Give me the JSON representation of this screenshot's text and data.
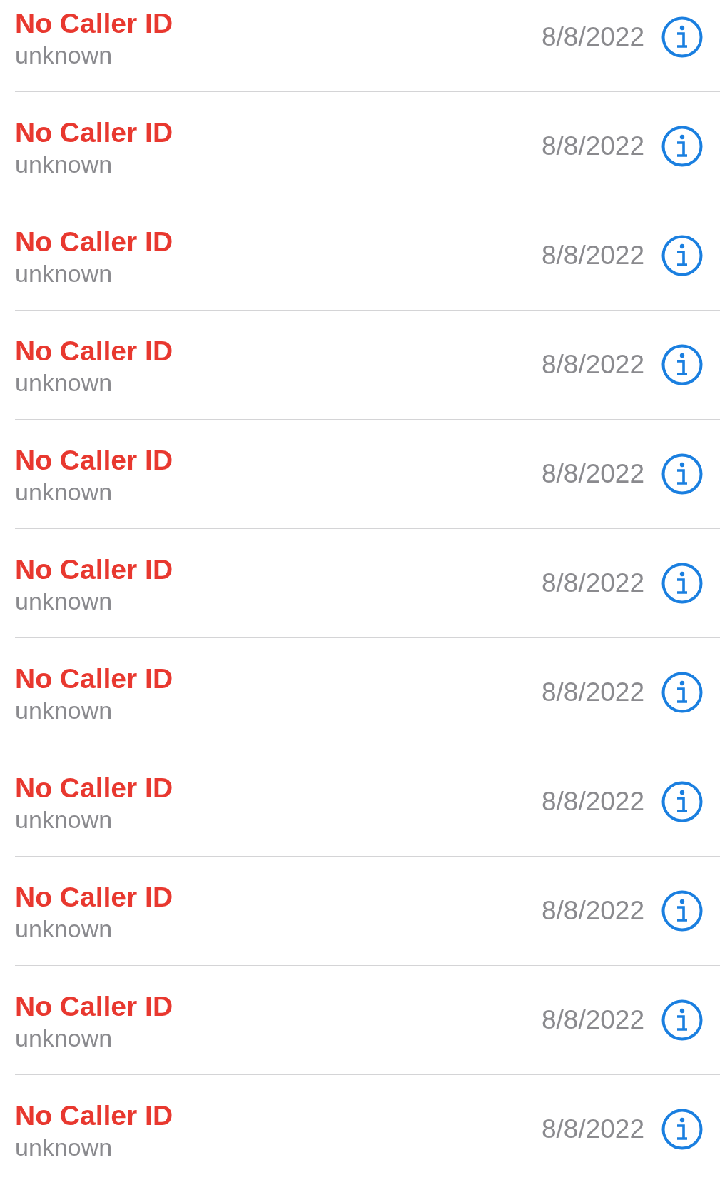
{
  "calls": [
    {
      "caller": "No Caller ID",
      "label": "unknown",
      "date": "8/8/2022",
      "missed": true
    },
    {
      "caller": "No Caller ID",
      "label": "unknown",
      "date": "8/8/2022",
      "missed": true
    },
    {
      "caller": "No Caller ID",
      "label": "unknown",
      "date": "8/8/2022",
      "missed": true
    },
    {
      "caller": "No Caller ID",
      "label": "unknown",
      "date": "8/8/2022",
      "missed": true
    },
    {
      "caller": "No Caller ID",
      "label": "unknown",
      "date": "8/8/2022",
      "missed": true
    },
    {
      "caller": "No Caller ID",
      "label": "unknown",
      "date": "8/8/2022",
      "missed": true
    },
    {
      "caller": "No Caller ID",
      "label": "unknown",
      "date": "8/8/2022",
      "missed": true
    },
    {
      "caller": "No Caller ID",
      "label": "unknown",
      "date": "8/8/2022",
      "missed": true
    },
    {
      "caller": "No Caller ID",
      "label": "unknown",
      "date": "8/8/2022",
      "missed": true
    },
    {
      "caller": "No Caller ID",
      "label": "unknown",
      "date": "8/8/2022",
      "missed": true
    },
    {
      "caller": "No Caller ID",
      "label": "unknown",
      "date": "8/8/2022",
      "missed": true
    }
  ]
}
